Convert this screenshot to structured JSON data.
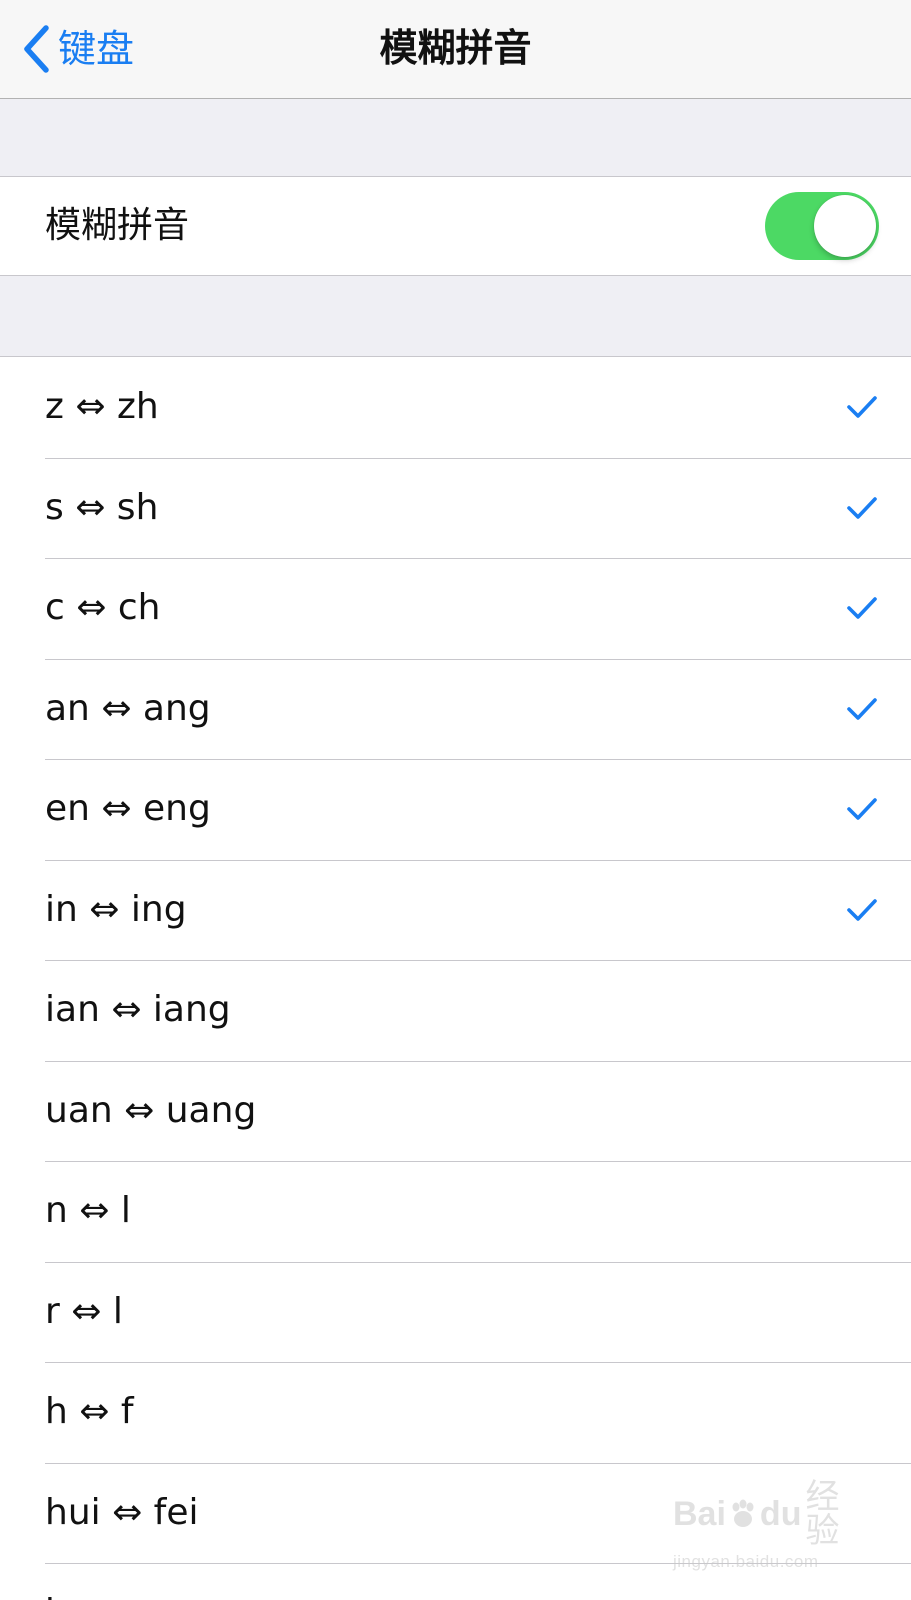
{
  "nav": {
    "back_label": "键盘",
    "title": "模糊拼音"
  },
  "main_toggle": {
    "label": "模糊拼音",
    "state": "on"
  },
  "options": [
    {
      "label": "z ⇔ zh",
      "checked": true
    },
    {
      "label": "s ⇔ sh",
      "checked": true
    },
    {
      "label": "c ⇔ ch",
      "checked": true
    },
    {
      "label": "an ⇔ ang",
      "checked": true
    },
    {
      "label": "en ⇔ eng",
      "checked": true
    },
    {
      "label": "in ⇔ ing",
      "checked": true
    },
    {
      "label": "ian ⇔ iang",
      "checked": false
    },
    {
      "label": "uan ⇔ uang",
      "checked": false
    },
    {
      "label": "n ⇔ l",
      "checked": false
    },
    {
      "label": "r ⇔ l",
      "checked": false
    },
    {
      "label": "h ⇔ f",
      "checked": false
    },
    {
      "label": "hui ⇔ fei",
      "checked": false
    },
    {
      "label": "h",
      "checked": false
    }
  ],
  "watermark": {
    "brand": "Bai",
    "paw_text": "du",
    "cn_text": "经验",
    "url": "jingyan.baidu.com"
  },
  "colors": {
    "accent": "#1a7ef2",
    "toggle_on": "#4cd964",
    "background": "#efeff4",
    "separator": "#c8c7cc"
  }
}
